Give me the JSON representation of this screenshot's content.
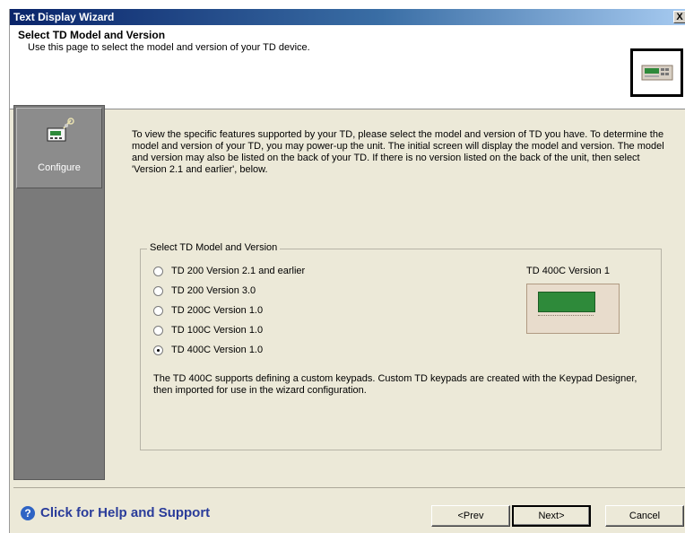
{
  "window": {
    "title": "Text Display Wizard",
    "close_glyph": "X"
  },
  "header": {
    "title": "Select TD Model and Version",
    "subtitle": "Use this page to select the model and version of your TD device.",
    "icon": "td-device-icon"
  },
  "sidebar": {
    "items": [
      {
        "label": "Configure",
        "icon": "configure-icon"
      }
    ]
  },
  "intro_text": "To view the specific features supported by your TD, please select the model and version of TD you have. To determine the model and version of your TD, you may power-up the unit. The initial screen will display the model and version. The model and version may also be listed on the back of your TD. If there is no version listed on the back of the unit, then select 'Version 2.1 and earlier', below.",
  "model_group": {
    "legend": "Select TD Model and Version",
    "options": [
      {
        "label": "TD 200 Version 2.1 and earlier",
        "checked": false
      },
      {
        "label": "TD 200 Version 3.0",
        "checked": false
      },
      {
        "label": "TD 200C Version 1.0",
        "checked": false
      },
      {
        "label": "TD 100C Version 1.0",
        "checked": false
      },
      {
        "label": "TD 400C Version 1.0",
        "checked": true
      }
    ],
    "preview_label": "TD 400C Version 1",
    "note": "The TD 400C supports defining a custom keypads. Custom TD keypads are created with the Keypad Designer, then imported for use in the wizard configuration."
  },
  "footer": {
    "help_label": "Click for Help and Support",
    "prev_label": "<Prev",
    "next_label": "Next>",
    "cancel_label": "Cancel"
  },
  "colors": {
    "titlebar_start": "#0a246a",
    "dialog_bg": "#ece9d8",
    "sidebar_bg": "#7a7a7a",
    "help_link": "#2a3c9a",
    "lcd_green": "#2e8a3a"
  }
}
